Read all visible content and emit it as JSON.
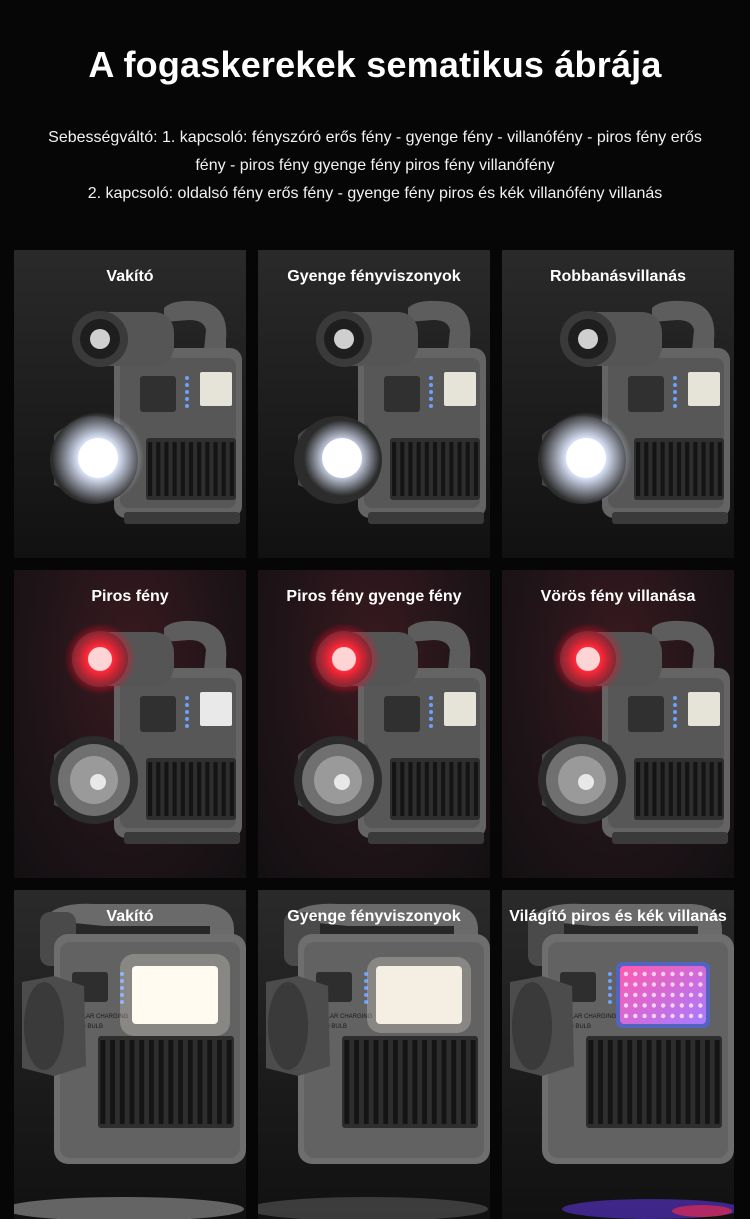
{
  "title": "A fogaskerekek sematikus ábrája",
  "description": {
    "line1": "Sebességváltó: 1. kapcsoló: fényszóró erős fény - gyenge fény - villanófény - piros fény erős",
    "line2": "fény - piros fény gyenge fény piros fény villanófény",
    "line3": "2. kapcsoló: oldalsó fény erős fény - gyenge fény piros és kék villanófény villanás"
  },
  "panels": [
    {
      "label": "Vakító",
      "mode": "head-strong"
    },
    {
      "label": "Gyenge fényviszonyok",
      "mode": "head-weak"
    },
    {
      "label": "Robbanásvillanás",
      "mode": "head-flash"
    },
    {
      "label": "Piros fény",
      "mode": "red-strong"
    },
    {
      "label": "Piros fény gyenge fény",
      "mode": "red-weak"
    },
    {
      "label": "Vörös fény villanása",
      "mode": "red-flash"
    },
    {
      "label": "Vakító",
      "mode": "side-strong"
    },
    {
      "label": "Gyenge fényviszonyok",
      "mode": "side-weak"
    },
    {
      "label": "Világító piros és kék villanás",
      "mode": "side-redblue"
    }
  ],
  "device_print": {
    "line1": "SOLAR CHARGING",
    "line2": "LED BULB"
  }
}
